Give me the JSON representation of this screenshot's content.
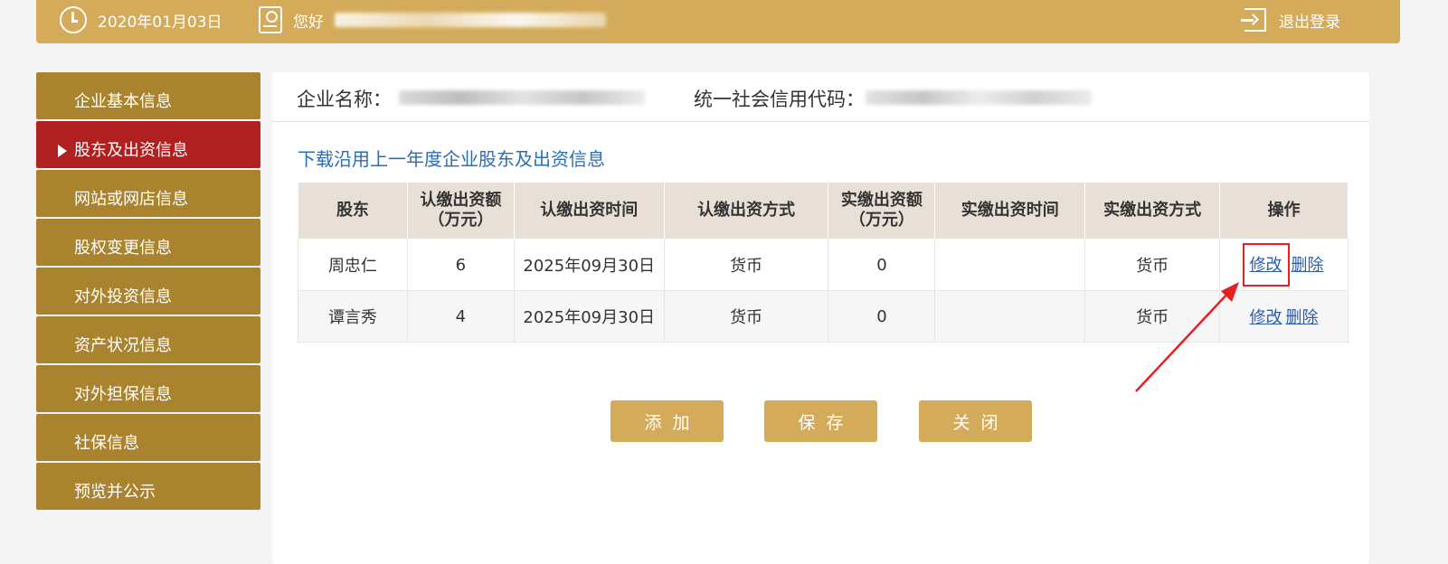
{
  "header": {
    "date": "2020年01月03日",
    "greeting": "您好",
    "logout_label": "退出登录"
  },
  "sidebar": {
    "items": [
      {
        "label": "企业基本信息",
        "active": false
      },
      {
        "label": "股东及出资信息",
        "active": true
      },
      {
        "label": "网站或网店信息",
        "active": false
      },
      {
        "label": "股权变更信息",
        "active": false
      },
      {
        "label": "对外投资信息",
        "active": false
      },
      {
        "label": "资产状况信息",
        "active": false
      },
      {
        "label": "对外担保信息",
        "active": false
      },
      {
        "label": "社保信息",
        "active": false
      },
      {
        "label": "预览并公示",
        "active": false
      }
    ]
  },
  "main": {
    "company_name_label": "企业名称：",
    "credit_code_label": "统一社会信用代码：",
    "download_link": "下载沿用上一年度企业股东及出资信息",
    "table": {
      "headers": [
        "股东",
        "认缴出资额（万元）",
        "认缴出资时间",
        "认缴出资方式",
        "实缴出资额（万元）",
        "实缴出资时间",
        "实缴出资方式",
        "操作"
      ],
      "rows": [
        {
          "shareholder": "周忠仁",
          "subscribed_amount": "6",
          "subscribed_time": "2025年09月30日",
          "subscribed_method": "货币",
          "paid_amount": "0",
          "paid_time": "",
          "paid_method": "货币"
        },
        {
          "shareholder": "谭言秀",
          "subscribed_amount": "4",
          "subscribed_time": "2025年09月30日",
          "subscribed_method": "货币",
          "paid_amount": "0",
          "paid_time": "",
          "paid_method": "货币"
        }
      ],
      "edit_label": "修改",
      "delete_label": "删除"
    },
    "buttons": {
      "add": "添加",
      "save": "保存",
      "close": "关闭"
    }
  },
  "colors": {
    "gold": "#d4ab5a",
    "sidebar_gold": "#aa832e",
    "active_red": "#b02020",
    "link_blue": "#2a6db8",
    "annotation_red": "#e62020"
  }
}
